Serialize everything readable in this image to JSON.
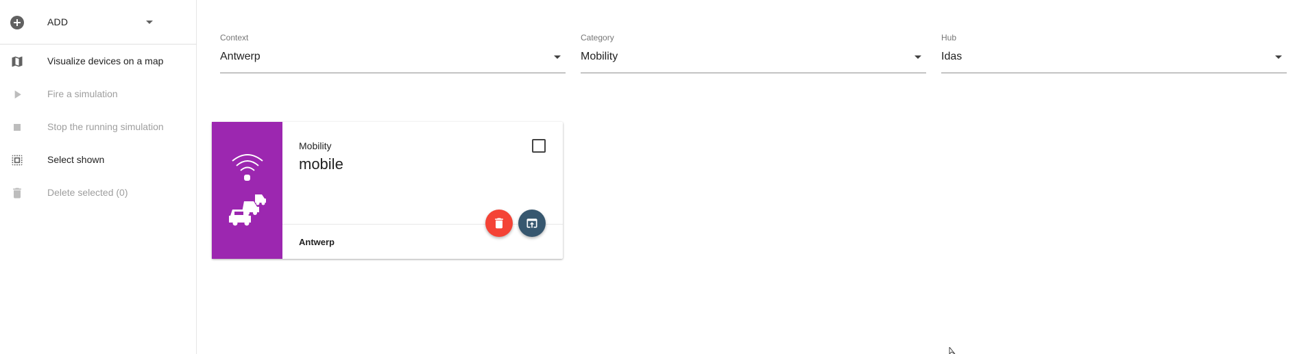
{
  "sidebar": {
    "add": {
      "label": "ADD",
      "icon": "add-circle-icon"
    },
    "items": [
      {
        "label": "Visualize devices on a map",
        "icon": "map-icon",
        "enabled": true
      },
      {
        "label": "Fire a simulation",
        "icon": "play-icon",
        "enabled": false
      },
      {
        "label": "Stop the running simulation",
        "icon": "stop-icon",
        "enabled": false
      },
      {
        "label": "Select shown",
        "icon": "select-all-icon",
        "enabled": true
      },
      {
        "label": "Delete selected (0)",
        "icon": "trash-icon",
        "enabled": false
      }
    ]
  },
  "filters": {
    "context": {
      "label": "Context",
      "value": "Antwerp"
    },
    "category": {
      "label": "Category",
      "value": "Mobility"
    },
    "hub": {
      "label": "Hub",
      "value": "Idas"
    }
  },
  "card": {
    "category": "Mobility",
    "name": "mobile",
    "context": "Antwerp",
    "accent_color": "#9c27b0",
    "checked": false,
    "icons": [
      "wifi-icon",
      "traffic-cars-icon"
    ]
  },
  "colors": {
    "delete": "#f44336",
    "open": "#37576f"
  }
}
